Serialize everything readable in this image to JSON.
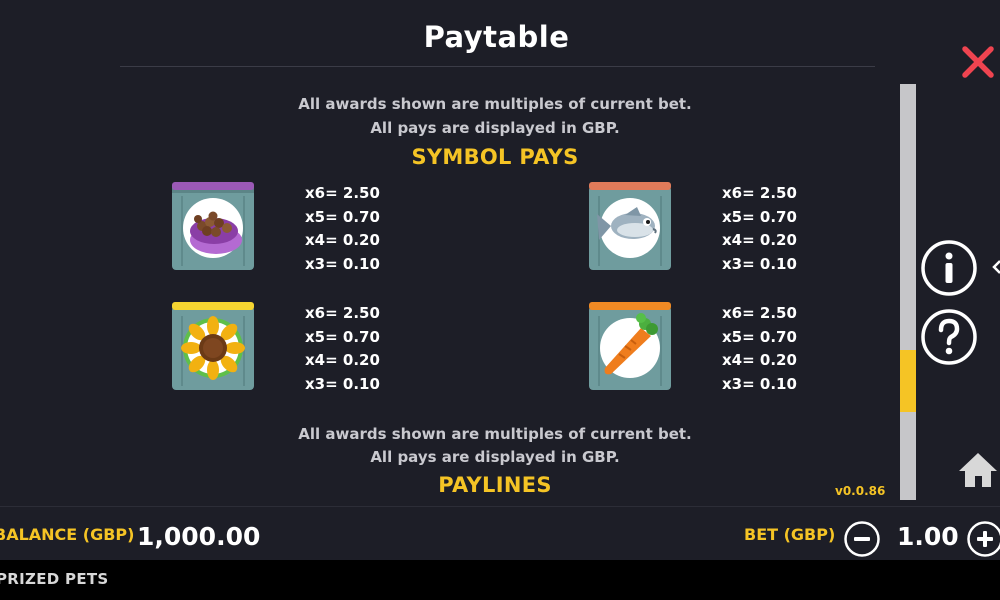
{
  "header": {
    "title": "Paytable"
  },
  "paytable": {
    "intro_line1": "All awards shown are multiples of current bet.",
    "intro_line2": "All pays are displayed in GBP.",
    "symbol_pays_heading": "SYMBOL PAYS",
    "symbols": [
      {
        "icon": "pet-food-bowl-bag-icon",
        "band_color": "#9b59b6",
        "pays": [
          "x6= 2.50",
          "x5= 0.70",
          "x4= 0.20",
          "x3= 0.10"
        ]
      },
      {
        "icon": "fish-bag-icon",
        "band_color": "#e07b5a",
        "pays": [
          "x6= 2.50",
          "x5= 0.70",
          "x4= 0.20",
          "x3= 0.10"
        ]
      },
      {
        "icon": "sunflower-seeds-bag-icon",
        "band_color": "#f5d531",
        "pays": [
          "x6= 2.50",
          "x5= 0.70",
          "x4= 0.20",
          "x3= 0.10"
        ]
      },
      {
        "icon": "carrot-bag-icon",
        "band_color": "#f08a24",
        "pays": [
          "x6= 2.50",
          "x5= 0.70",
          "x4= 0.20",
          "x3= 0.10"
        ]
      }
    ],
    "outro_line1": "All awards shown are multiples of current bet.",
    "outro_line2": "All pays are displayed in GBP.",
    "paylines_heading": "PAYLINES"
  },
  "version": "v0.0.86",
  "scroll": {
    "position_fraction": 0.75,
    "visible_fraction": 0.15
  },
  "side_buttons": {
    "info_icon": "info-icon",
    "help_icon": "question-mark-icon",
    "home_icon": "home-icon",
    "close_icon": "close-icon"
  },
  "footer": {
    "balance_label": "BALANCE (GBP)",
    "balance_value": "1,000.00",
    "bet_label": "BET (GBP)",
    "bet_value": "1.00",
    "game_name": "PRIZED PETS"
  },
  "colors": {
    "background": "#1d1e27",
    "accent_yellow": "#f5c425",
    "close_red": "#ef4450",
    "bag_teal": "#6f9c9e"
  }
}
